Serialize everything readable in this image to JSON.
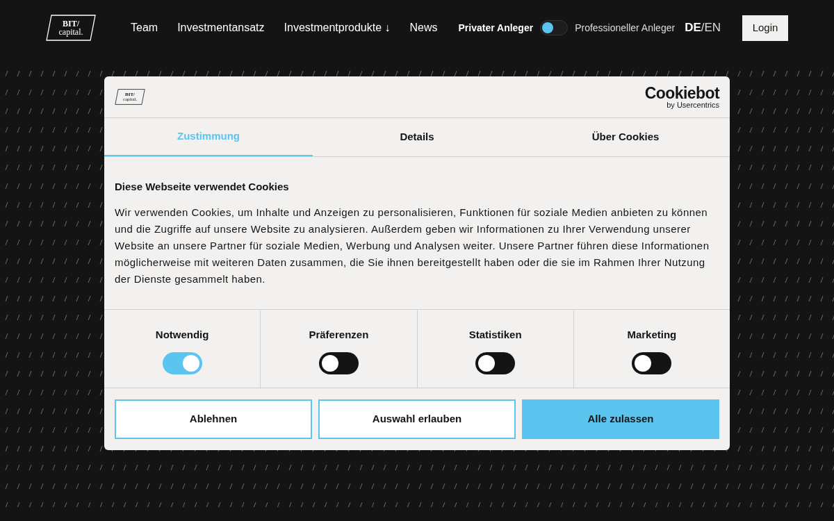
{
  "header": {
    "logo": {
      "top": "BIT/",
      "bottom": "capital."
    },
    "nav": [
      {
        "label": "Team"
      },
      {
        "label": "Investmentansatz"
      },
      {
        "label": "Investmentprodukte ↓"
      },
      {
        "label": "News"
      }
    ],
    "audience": {
      "private_label": "Privater Anleger",
      "professional_label": "Professioneller Anleger",
      "professional": false
    },
    "languages": [
      {
        "label": "DE",
        "selected": true
      },
      {
        "label": "EN",
        "selected": false
      }
    ],
    "language_separator": "/",
    "login": "Login"
  },
  "cookie_dialog": {
    "logo": {
      "top": "BIT/",
      "bottom": "capital."
    },
    "provider": {
      "name": "Cookiebot",
      "by": "by Usercentrics"
    },
    "tabs": [
      {
        "label": "Zustimmung",
        "selected": true
      },
      {
        "label": "Details",
        "selected": false
      },
      {
        "label": "Über Cookies",
        "selected": false
      }
    ],
    "title": "Diese Webseite verwendet Cookies",
    "text": "Wir verwenden Cookies, um Inhalte und Anzeigen zu personalisieren, Funktionen für soziale Medien anbieten zu können und die Zugriffe auf unsere Website zu analysieren. Außerdem geben wir Informationen zu Ihrer Verwendung unserer Website an unsere Partner für soziale Medien, Werbung und Analysen weiter. Unsere Partner führen diese Informationen möglicherweise mit weiteren Daten zusammen, die Sie ihnen bereitgestellt haben oder die sie im Rahmen Ihrer Nutzung der Dienste gesammelt haben.",
    "categories": [
      {
        "label": "Notwendig",
        "on": true
      },
      {
        "label": "Präferenzen",
        "on": false
      },
      {
        "label": "Statistiken",
        "on": false
      },
      {
        "label": "Marketing",
        "on": false
      }
    ],
    "buttons": [
      {
        "label": "Ablehnen",
        "kind": "outline"
      },
      {
        "label": "Auswahl erlauben",
        "kind": "outline"
      },
      {
        "label": "Alle zulassen",
        "kind": "primary"
      }
    ]
  }
}
